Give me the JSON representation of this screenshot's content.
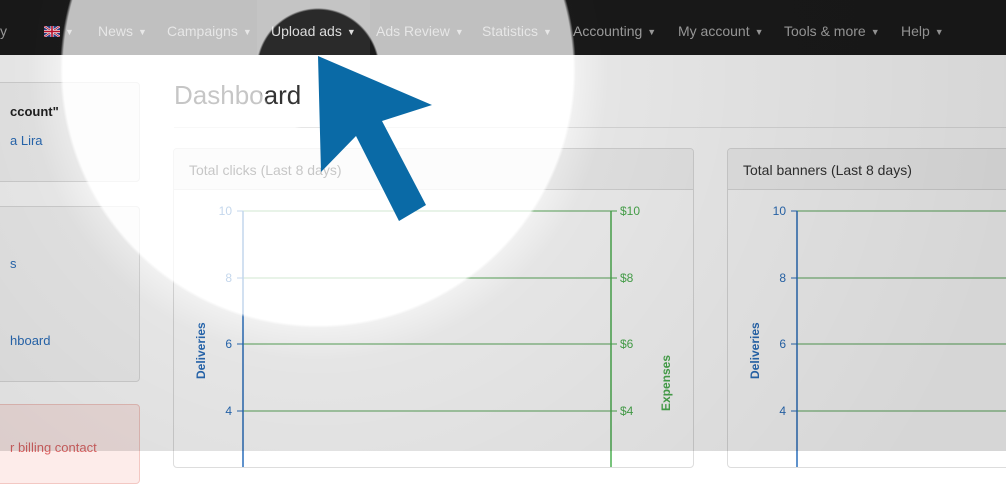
{
  "nav": {
    "brand_tail": "y",
    "items": [
      {
        "label": "News"
      },
      {
        "label": "Campaigns"
      },
      {
        "label": "Upload ads"
      },
      {
        "label": "Ads Review"
      },
      {
        "label": "Statistics"
      },
      {
        "label": "Accounting"
      },
      {
        "label": "My account"
      },
      {
        "label": "Tools & more"
      },
      {
        "label": "Help"
      }
    ]
  },
  "sidebar": {
    "account_label": "ccount\"",
    "account_user": "a Lira",
    "link_s": "s",
    "link_dashboard": "hboard",
    "billing_notice": "r billing contact"
  },
  "page": {
    "title": "Dashboard"
  },
  "charts": [
    {
      "title": "Total clicks (Last 8 days)",
      "left_axis": {
        "label": "Deliveries",
        "ticks": [
          "10",
          "8",
          "6",
          "4"
        ],
        "color": "#2a6ebb"
      },
      "right_axis": {
        "label": "Expenses",
        "ticks": [
          "$10",
          "$8",
          "$6",
          "$4"
        ],
        "color": "#4caf50"
      }
    },
    {
      "title": "Total banners (Last 8 days)",
      "left_axis": {
        "label": "Deliveries",
        "ticks": [
          "10",
          "8",
          "6",
          "4"
        ],
        "color": "#2a6ebb"
      }
    }
  ],
  "colors": {
    "navbar": "#1b1b1b",
    "arrow": "#0a6aa6",
    "deliveries_axis": "#2a6ebb",
    "expenses_axis": "#4caf50"
  }
}
